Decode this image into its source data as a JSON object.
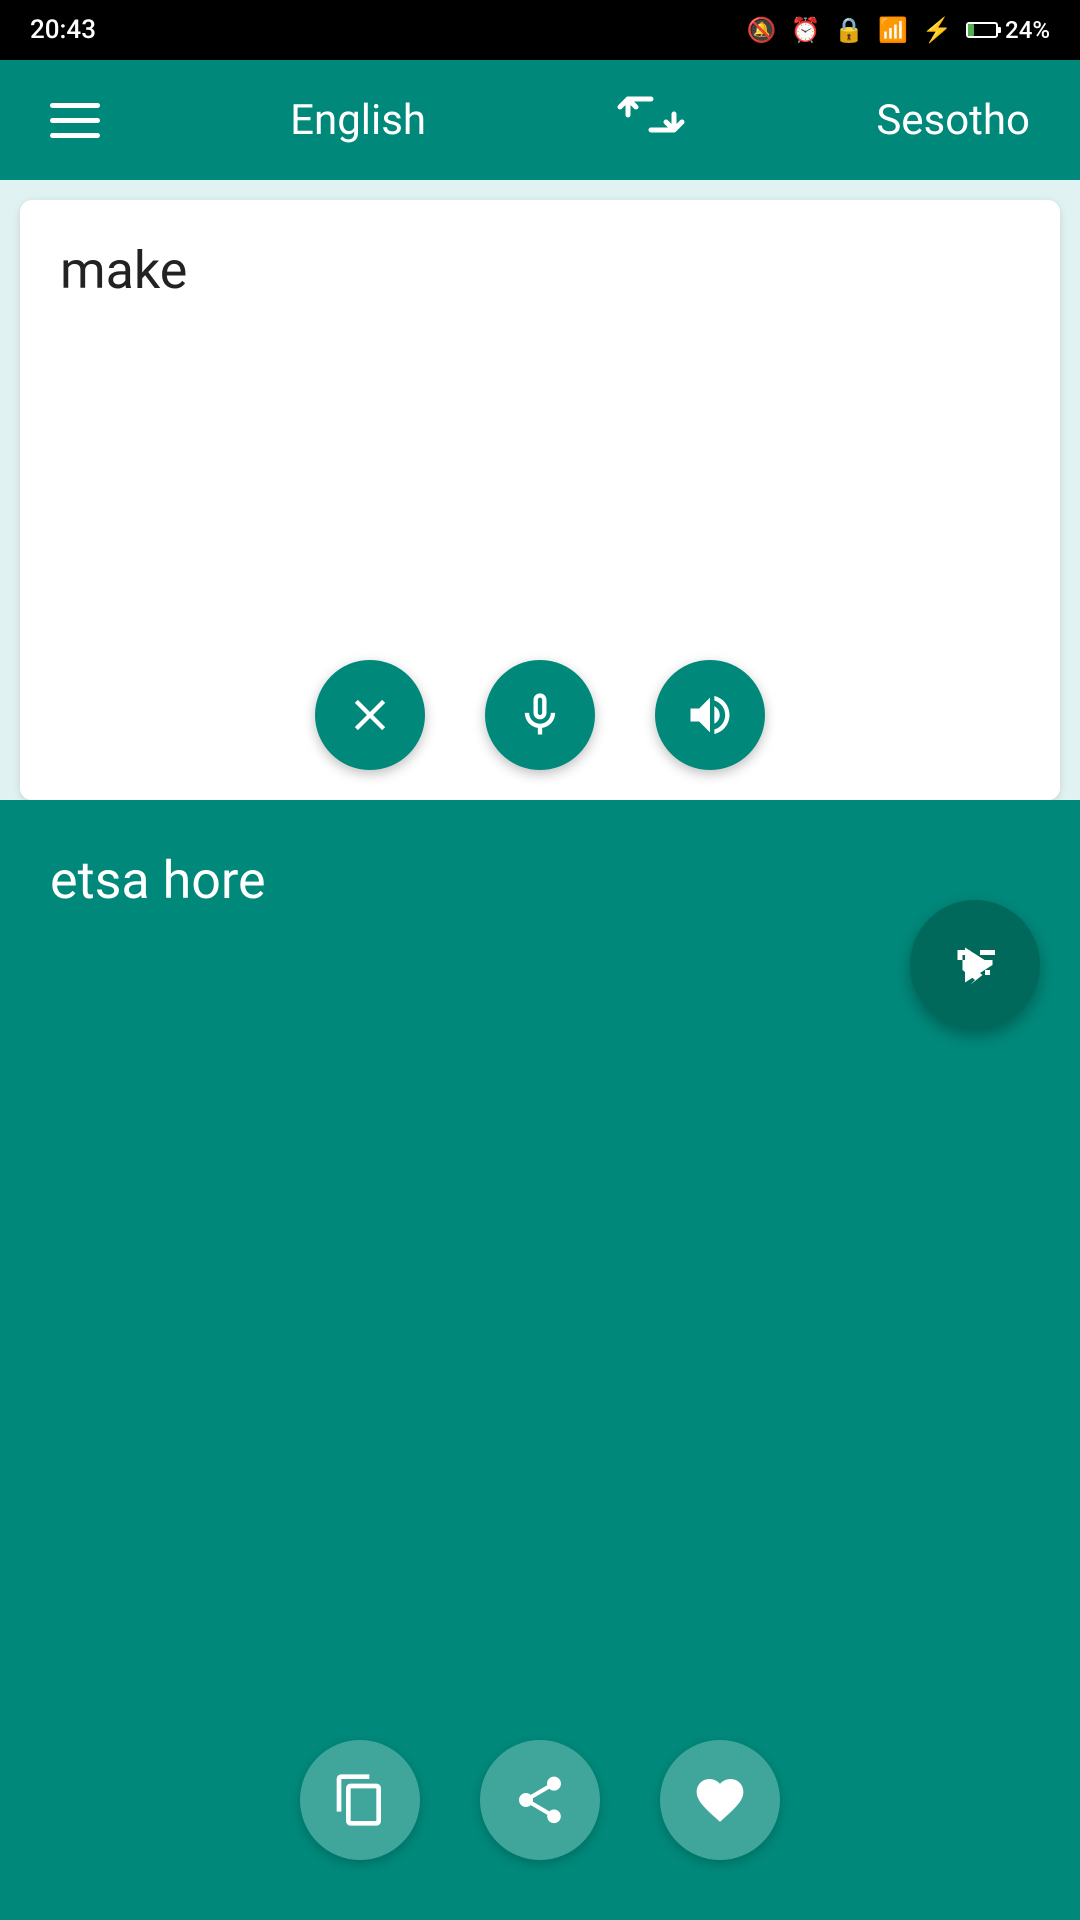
{
  "status_bar": {
    "time": "20:43",
    "battery_percent": "24%"
  },
  "toolbar": {
    "menu_icon_label": "menu",
    "source_language": "English",
    "swap_icon_label": "swap languages",
    "target_language": "Sesotho"
  },
  "source_panel": {
    "input_text": "make",
    "clear_btn_label": "clear",
    "mic_btn_label": "microphone",
    "speaker_btn_label": "speak"
  },
  "translate_fab": {
    "label": "translate"
  },
  "target_panel": {
    "output_text": "etsa hore",
    "copy_btn_label": "copy",
    "share_btn_label": "share",
    "favorite_btn_label": "favorite"
  }
}
